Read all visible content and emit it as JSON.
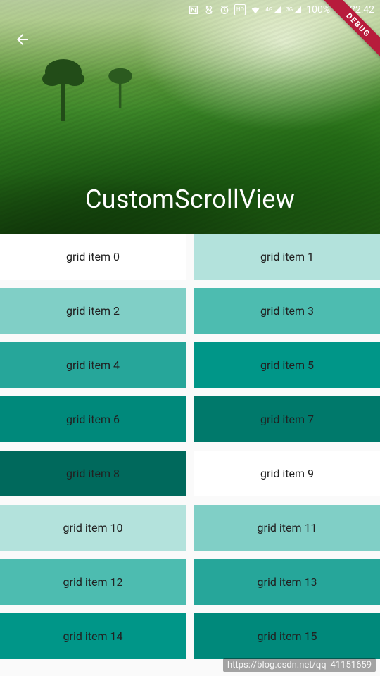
{
  "status": {
    "battery_pct_text": "100%",
    "clock": "22:42",
    "network_4g": "4G",
    "network_3g": "3G"
  },
  "debug_banner": "DEBUG",
  "header": {
    "title": "CustomScrollView"
  },
  "grid": {
    "items": [
      {
        "label": "grid item 0",
        "color": "#ffffff"
      },
      {
        "label": "grid item 1",
        "color": "#b3e2dc"
      },
      {
        "label": "grid item 2",
        "color": "#80cfc6"
      },
      {
        "label": "grid item 3",
        "color": "#4dbcb0"
      },
      {
        "label": "grid item 4",
        "color": "#26a69a"
      },
      {
        "label": "grid item 5",
        "color": "#009688"
      },
      {
        "label": "grid item 6",
        "color": "#00897b"
      },
      {
        "label": "grid item 7",
        "color": "#00796b"
      },
      {
        "label": "grid item 8",
        "color": "#00695c"
      },
      {
        "label": "grid item 9",
        "color": "#ffffff"
      },
      {
        "label": "grid item 10",
        "color": "#b3e2dc"
      },
      {
        "label": "grid item 11",
        "color": "#80cfc6"
      },
      {
        "label": "grid item 12",
        "color": "#4dbcb0"
      },
      {
        "label": "grid item 13",
        "color": "#26a69a"
      },
      {
        "label": "grid item 14",
        "color": "#009688"
      },
      {
        "label": "grid item 15",
        "color": "#00897b"
      }
    ]
  },
  "watermark": "https://blog.csdn.net/qq_41151659"
}
